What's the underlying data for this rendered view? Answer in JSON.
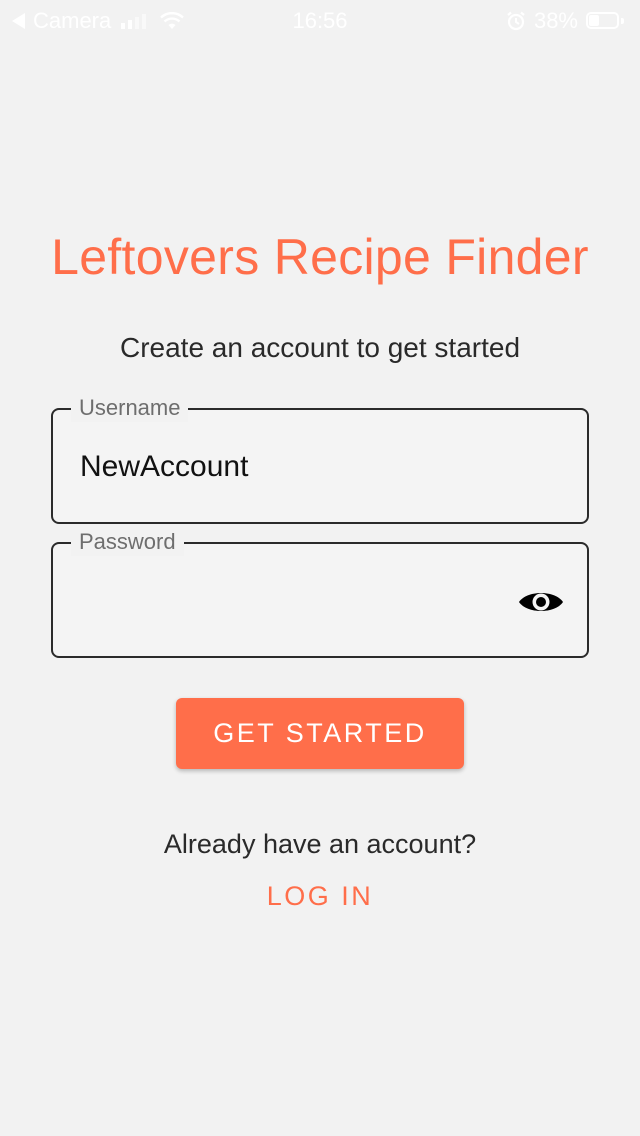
{
  "theme": {
    "accent": "#ff6e4a",
    "background": "#f2f2f2"
  },
  "status_bar": {
    "back_label": "Camera",
    "time": "16:56",
    "battery": "38%",
    "battery_level": 0.38,
    "icons": [
      "back-arrow-icon",
      "signal-icon",
      "wifi-icon",
      "alarm-icon",
      "battery-icon"
    ]
  },
  "app": {
    "title": "Leftovers Recipe Finder",
    "subtitle": "Create an account to get started"
  },
  "form": {
    "username": {
      "label": "Username",
      "value": "NewAccount"
    },
    "password": {
      "label": "Password",
      "value": "",
      "toggle_icon": "eye-icon"
    },
    "submit_label": "GET STARTED"
  },
  "footer": {
    "prompt": "Already have an account?",
    "login_label": "LOG IN"
  }
}
